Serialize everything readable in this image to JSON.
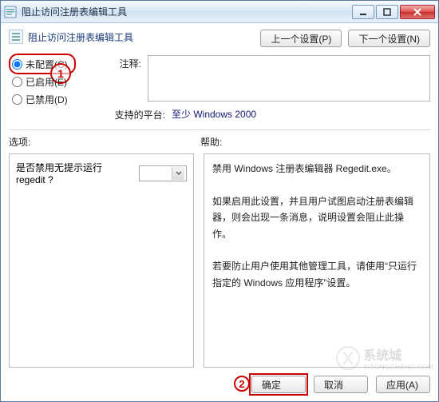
{
  "window": {
    "title": "阻止访问注册表编辑工具"
  },
  "header": {
    "page_title": "阻止访问注册表编辑工具",
    "prev_btn": "上一个设置(P)",
    "next_btn": "下一个设置(N)"
  },
  "radio": {
    "not_configured": "未配置(C)",
    "enabled": "已启用(E)",
    "disabled": "已禁用(D)",
    "selected": "not_configured"
  },
  "comment": {
    "label": "注释:",
    "value": ""
  },
  "platform": {
    "label": "支持的平台:",
    "value": "至少 Windows 2000"
  },
  "section": {
    "options_label": "选项:",
    "help_label": "帮助:"
  },
  "options": {
    "line1": "是否禁用无提示运行 regedit ?",
    "combo_value": ""
  },
  "help": {
    "text": "禁用 Windows 注册表编辑器 Regedit.exe。\n\n如果启用此设置，并且用户试图启动注册表编辑器，则会出现一条消息，说明设置会阻止此操作。\n\n若要防止用户使用其他管理工具，请使用“只运行指定的 Windows 应用程序”设置。"
  },
  "footer": {
    "ok": "确定",
    "cancel": "取消",
    "apply": "应用(A)"
  },
  "annotations": {
    "one": "1",
    "two": "2"
  },
  "watermark": {
    "brand": "系统城",
    "url": "XITONGCHENG.COM"
  }
}
